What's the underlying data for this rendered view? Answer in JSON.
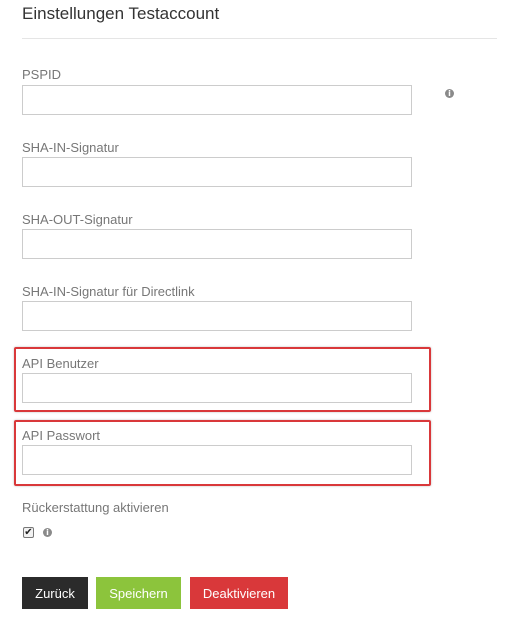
{
  "page": {
    "title": "Einstellungen Testaccount"
  },
  "fields": {
    "pspid": {
      "label": "PSPID",
      "value": ""
    },
    "sha_in": {
      "label": "SHA-IN-Signatur",
      "value": ""
    },
    "sha_out": {
      "label": "SHA-OUT-Signatur",
      "value": ""
    },
    "sha_in_directlink": {
      "label": "SHA-IN-Signatur für Directlink",
      "value": ""
    },
    "api_user": {
      "label": "API Benutzer",
      "value": ""
    },
    "api_password": {
      "label": "API Passwort",
      "value": ""
    }
  },
  "refund": {
    "label": "Rückerstattung aktivieren",
    "checked": true,
    "check_glyph": "✔"
  },
  "icons": {
    "info": "info-icon",
    "info_glyph": "i"
  },
  "buttons": {
    "back": "Zurück",
    "save": "Speichern",
    "deactivate": "Deaktivieren"
  },
  "colors": {
    "highlight_border": "#d9383a",
    "back_button": "#2b2b2b",
    "save_button": "#8cc43c",
    "deactivate_button": "#d9383a"
  }
}
